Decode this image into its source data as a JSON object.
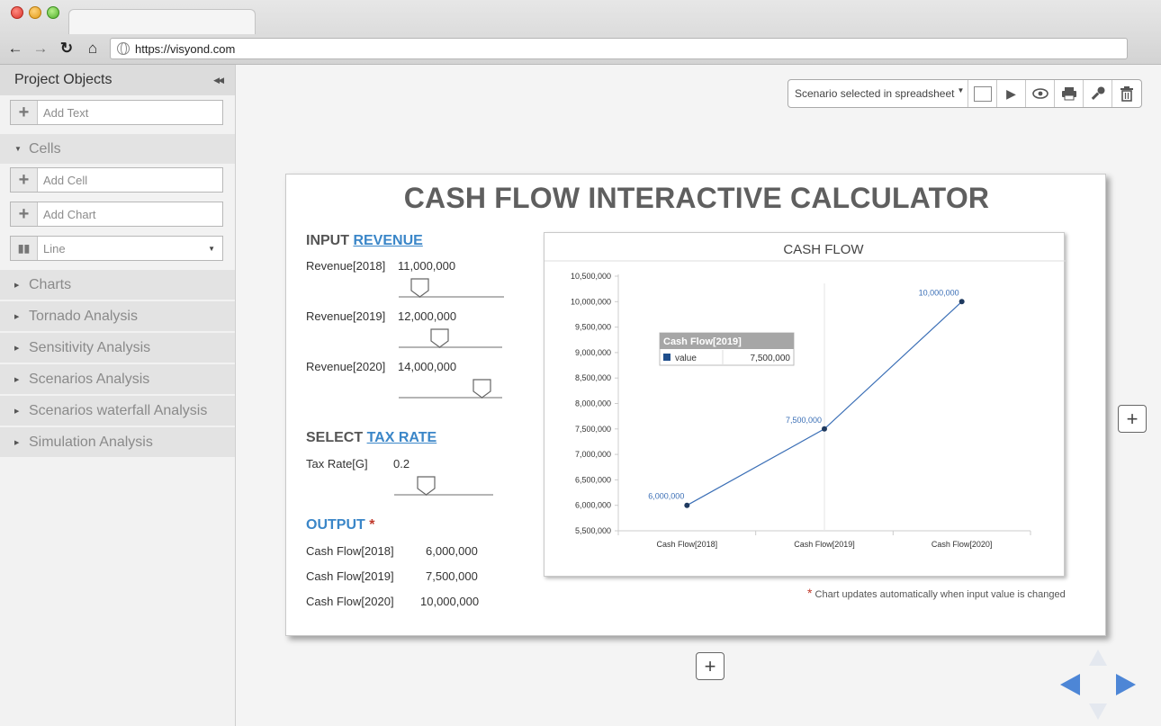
{
  "browser": {
    "url": "https://visyond.com"
  },
  "sidebar": {
    "title": "Project Objects",
    "add_text": "Add Text",
    "cells_section": "Cells",
    "add_cell": "Add Cell",
    "add_chart": "Add Chart",
    "chart_type": "Line",
    "sections": [
      "Charts",
      "Tornado Analysis",
      "Sensitivity Analysis",
      "Scenarios Analysis",
      "Scenarios waterfall Analysis",
      "Simulation Analysis"
    ]
  },
  "toolbar": {
    "scenario_select": "Scenario selected in spreadsheet"
  },
  "document": {
    "title": "CASH FLOW INTERACTIVE CALCULATOR",
    "input_prefix": "INPUT",
    "input_link": "REVENUE",
    "inputs": [
      {
        "label": "Revenue[2018]",
        "value": "11,000,000"
      },
      {
        "label": "Revenue[2019]",
        "value": "12,000,000"
      },
      {
        "label": "Revenue[2020]",
        "value": "14,000,000"
      }
    ],
    "select_prefix": "SELECT",
    "select_link": "TAX RATE",
    "tax": {
      "label": "Tax Rate[G]",
      "value": "0.2"
    },
    "output_title": "OUTPUT",
    "output_star": "*",
    "outputs": [
      {
        "label": "Cash Flow[2018]",
        "value": "6,000,000"
      },
      {
        "label": "Cash Flow[2019]",
        "value": "7,500,000"
      },
      {
        "label": "Cash Flow[2020]",
        "value": "10,000,000"
      }
    ],
    "note_star": "*",
    "note": "Chart updates automatically when input value is changed"
  },
  "chart_data": {
    "type": "line",
    "title": "CASH FLOW",
    "categories": [
      "Cash Flow[2018]",
      "Cash Flow[2019]",
      "Cash Flow[2020]"
    ],
    "series": [
      {
        "name": "value",
        "values": [
          6000000,
          7500000,
          10000000
        ]
      }
    ],
    "data_labels": [
      "6,000,000",
      "7,500,000",
      "10,000,000"
    ],
    "ylim": [
      5500000,
      10500000
    ],
    "yticks": [
      "5,500,000",
      "6,000,000",
      "6,500,000",
      "7,000,000",
      "7,500,000",
      "8,000,000",
      "8,500,000",
      "9,000,000",
      "9,500,000",
      "10,000,000",
      "10,500,000"
    ],
    "tooltip": {
      "title": "Cash Flow[2019]",
      "series": "value",
      "value": "7,500,000"
    },
    "colors": {
      "line": "#3b6fb6",
      "label": "#3b6fb6",
      "point": "#1f3a5f"
    }
  }
}
